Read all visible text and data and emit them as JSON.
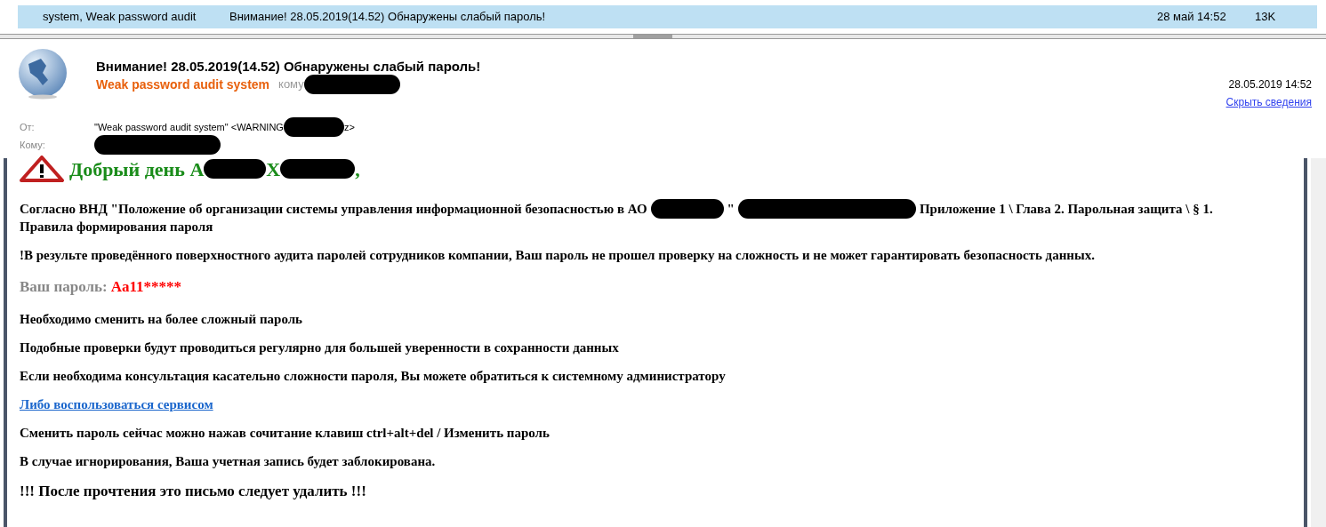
{
  "message_list": {
    "rows": [
      {
        "from": "system, Weak password audit",
        "subject": "Внимание! 28.05.2019(14.52) Обнаружены слабый пароль!",
        "date": "28 май 14:52",
        "size": "13K",
        "selected": true
      }
    ]
  },
  "header": {
    "subject": "Внимание! 28.05.2019(14.52) Обнаружены слабый пароль!",
    "sender": "Weak password audit system",
    "to_segments": [
      {
        "kind": "text",
        "text": "кому"
      },
      {
        "kind": "redaction"
      }
    ],
    "date": "28.05.2019 14:52",
    "hide_link": "Скрыть сведения"
  },
  "details": [
    {
      "label": "От:",
      "segments": [
        {
          "kind": "text",
          "text": "\"Weak password audit system\" <WARNING"
        },
        {
          "kind": "redaction"
        },
        {
          "kind": "text",
          "text": "z>"
        }
      ]
    },
    {
      "label": "Кому:",
      "segments": [
        {
          "kind": "redaction"
        }
      ]
    }
  ],
  "body": {
    "greeting": [
      {
        "kind": "text",
        "text": "Добрый день А"
      },
      {
        "kind": "redaction"
      },
      {
        "kind": "text",
        "text": "Х"
      },
      {
        "kind": "redaction"
      },
      {
        "kind": "text",
        "text": ","
      }
    ],
    "paragraphs": [
      {
        "kind": "segments",
        "lines": [
          [
            {
              "kind": "text",
              "text": "Согласно ВНД \"Положение об организации системы управления информационной безопасностью в АО"
            },
            {
              "kind": "redaction"
            },
            {
              "kind": "text",
              "text": "\""
            },
            {
              "kind": "redaction"
            },
            {
              "kind": "text",
              "text": "Приложение 1 \\ Глава 2. Парольная защита \\ § 1."
            }
          ],
          [
            {
              "kind": "text",
              "text": "Правила формирования пароля"
            }
          ]
        ]
      },
      {
        "kind": "text",
        "text": "!В результе проведённого поверхностного аудита паролей сотрудников компании, Ваш пароль не прошел проверку на сложность и не может гарантировать безопасность данных."
      },
      {
        "kind": "password",
        "label": "Ваш пароль:",
        "value": "Aa11*****"
      },
      {
        "kind": "text",
        "text": "Необходимо сменить на более сложный пароль"
      },
      {
        "kind": "text",
        "text": "Подобные проверки будут проводиться регулярно для большей уверенности в сохранности данных"
      },
      {
        "kind": "text",
        "text": "Если необходима консультация касательно сложности пароля, Вы можете обратиться к системному администратору"
      },
      {
        "kind": "link",
        "text": "Либо воспользоваться сервисом"
      },
      {
        "kind": "text",
        "text": "Сменить пароль сейчас можно нажав сочитание клавиш ctrl+alt+del / Изменить пароль"
      },
      {
        "kind": "text",
        "text": "В случае игнорирования, Ваша учетная запись будет заблокирована."
      },
      {
        "kind": "large",
        "text": "!!! После прочтения это письмо следует удалить !!!"
      }
    ]
  }
}
